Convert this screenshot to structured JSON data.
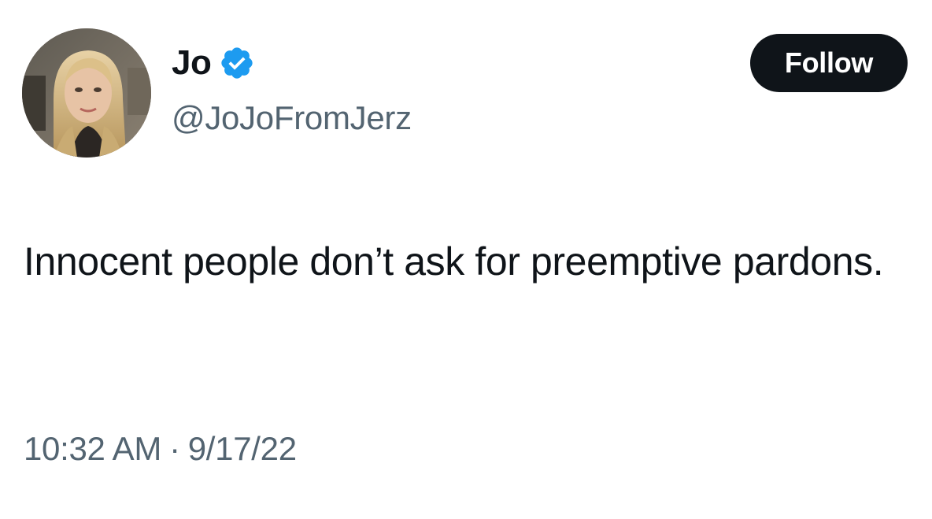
{
  "author": {
    "display_name": "Jo",
    "handle": "@JoJoFromJerz",
    "verified_icon": "verified-badge-icon",
    "avatar": "profile-photo"
  },
  "follow_button": {
    "label": "Follow"
  },
  "tweet": {
    "text": "Innocent people don’t ask for preemptive pardons.",
    "time": "10:32 AM",
    "separator": "·",
    "date": "9/17/22"
  },
  "colors": {
    "text_primary": "#0f1419",
    "text_secondary": "#536471",
    "verified_blue": "#1d9bf0",
    "follow_bg": "#0f1419",
    "follow_text": "#ffffff"
  }
}
